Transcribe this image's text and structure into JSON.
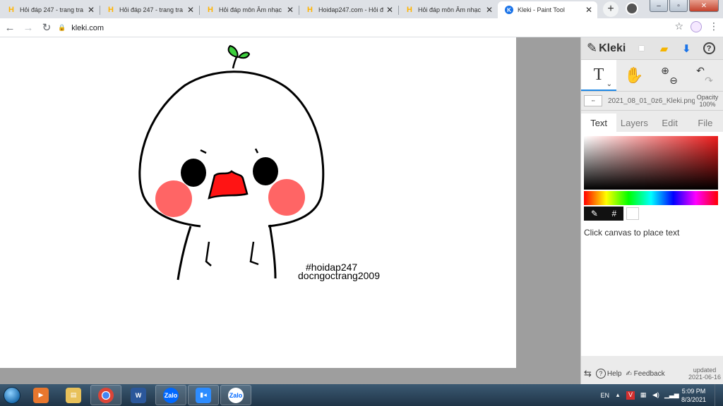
{
  "browser": {
    "tabs": [
      {
        "title": "Hỏi đáp 247 - trang tra",
        "icon": "hoidap-icon"
      },
      {
        "title": "Hỏi đáp 247 - trang tra",
        "icon": "hoidap-icon"
      },
      {
        "title": "Hỏi đáp môn Âm nhạc",
        "icon": "hoidap-icon"
      },
      {
        "title": "Hoidap247.com - Hỏi đ",
        "icon": "hoidap-icon"
      },
      {
        "title": "Hỏi đáp môn Âm nhạc",
        "icon": "hoidap-icon"
      },
      {
        "title": "Kleki - Paint Tool",
        "icon": "kleki-icon",
        "active": true
      }
    ],
    "url": "kleki.com"
  },
  "canvas": {
    "text_line_1": "#hoidap247",
    "text_line_2": "docngoctrang2009"
  },
  "panel": {
    "logo": "Kleki",
    "file_name": "2021_08_01_0z6_Kleki.png",
    "opacity_label": "Opacity",
    "opacity_value": "100%",
    "tabs": [
      "Text",
      "Layers",
      "Edit",
      "File"
    ],
    "active_tab": "Text",
    "hint": "Click canvas to place text",
    "footer": {
      "help": "Help",
      "feedback": "Feedback",
      "updated_label": "updated",
      "updated_date": "2021-06-16"
    },
    "colors": {
      "primary": "#ee1c1c",
      "secondary": "#ffffff"
    }
  },
  "taskbar": {
    "apps": [
      "start-orb",
      "media-player",
      "file-explorer",
      "chrome",
      "word",
      "zalo",
      "zoom",
      "zalo"
    ],
    "language": "EN",
    "time": "5:09 PM",
    "date": "8/3/2021"
  }
}
